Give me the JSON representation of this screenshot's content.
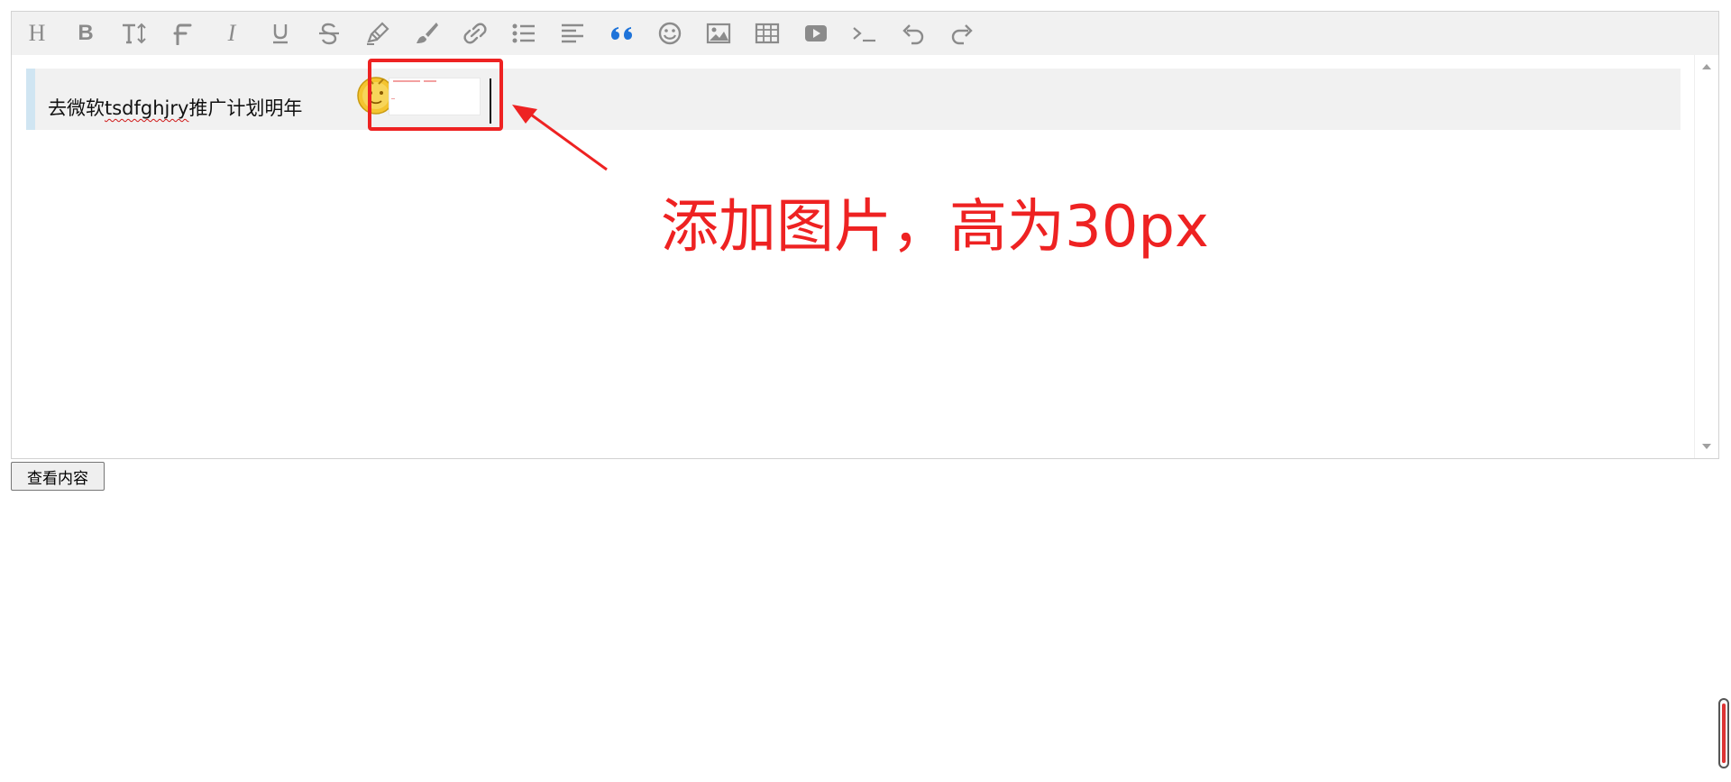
{
  "toolbar": {
    "tools": [
      {
        "name": "head-icon",
        "label": "H"
      },
      {
        "name": "bold-icon",
        "label": "B"
      },
      {
        "name": "font-size-icon"
      },
      {
        "name": "font-name-icon"
      },
      {
        "name": "italic-icon",
        "label": "I"
      },
      {
        "name": "underline-icon"
      },
      {
        "name": "strikethrough-icon"
      },
      {
        "name": "fore-color-icon"
      },
      {
        "name": "back-color-icon"
      },
      {
        "name": "link-icon"
      },
      {
        "name": "list-icon"
      },
      {
        "name": "justify-icon"
      },
      {
        "name": "quote-icon"
      },
      {
        "name": "emoticon-icon"
      },
      {
        "name": "image-icon"
      },
      {
        "name": "table-icon"
      },
      {
        "name": "video-icon"
      },
      {
        "name": "code-icon"
      },
      {
        "name": "undo-icon"
      },
      {
        "name": "redo-icon"
      }
    ],
    "icon_color": "#8b8b8b",
    "active_color": "#1e73d9"
  },
  "editor": {
    "quote_text_part1": "去微软",
    "quote_text_misspelled": "tsdfghjry",
    "quote_text_part2": "推广计划明年",
    "quote_background": "#f1f1f1",
    "quote_border_color": "#d0e5f2"
  },
  "annotation": {
    "text": "添加图片，高为30px",
    "color": "#ee2222"
  },
  "view_button": {
    "label": "查看内容"
  }
}
